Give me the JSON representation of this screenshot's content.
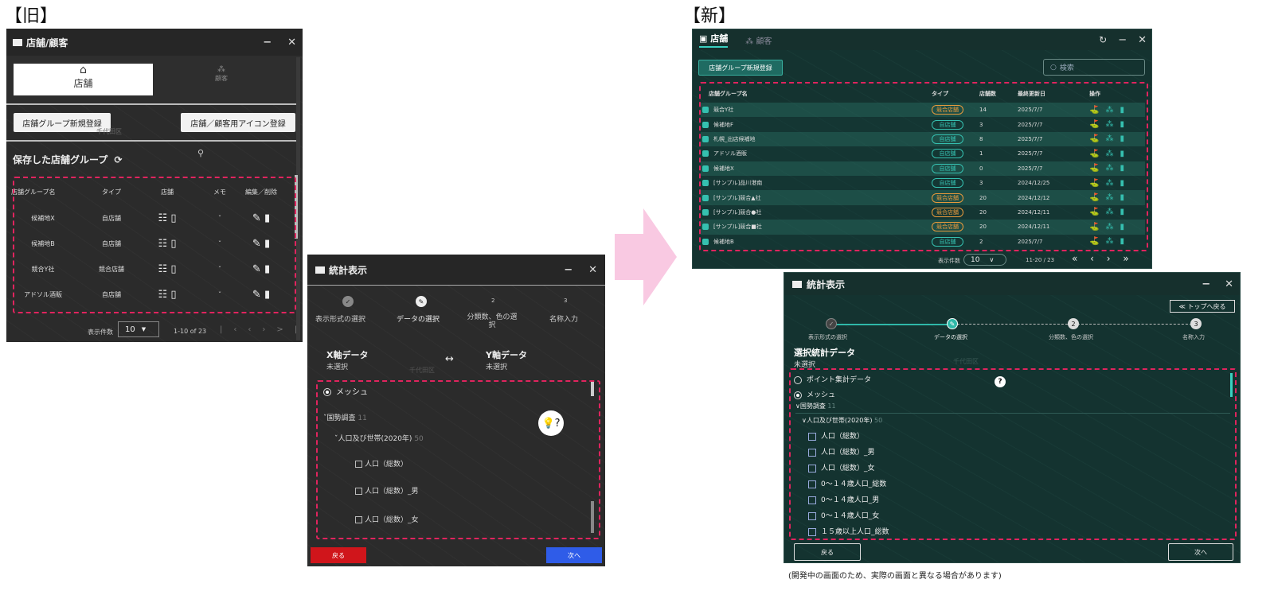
{
  "labels": {
    "old": "【旧】",
    "new": "【新】",
    "footnote": "(開発中の画面のため、実際の画面と異なる場合があります)"
  },
  "old_store": {
    "title": "店舗/顧客",
    "tab_store": "店舗",
    "tab_customer": "顧客",
    "btn_group_register": "店舗グループ新規登録",
    "btn_icon_register": "店舗／顧客用アイコン登録",
    "saved_groups": "保存した店舗グループ",
    "map_label": "千代田区",
    "columns": [
      "店舗グループ名",
      "タイプ",
      "店舗",
      "メモ",
      "編集／削除"
    ],
    "rows": [
      {
        "name": "候補地X",
        "type": "自店舗"
      },
      {
        "name": "候補地B",
        "type": "自店舗"
      },
      {
        "name": "競合Y社",
        "type": "競合店舗"
      },
      {
        "name": "アドソル酒販",
        "type": "自店舗"
      }
    ],
    "page_size_label": "表示件数",
    "page_size": "10",
    "range": "1-10 of 23"
  },
  "old_stats": {
    "title": "統計表示",
    "steps": [
      "表示形式の選択",
      "データの選択",
      "分類数、色の選択",
      "名称入力"
    ],
    "step_nums": [
      "2",
      "3"
    ],
    "x_label": "X軸データ",
    "x_value": "未選択",
    "y_label": "Y軸データ",
    "y_value": "未選択",
    "map_label": "千代田区",
    "mesh": "メッシュ",
    "census": "国勢調査",
    "census_count": "11",
    "pop": "人口及び世帯(2020年)",
    "pop_count": "50",
    "items": [
      "人口（総数）",
      "人口（総数）_男",
      "人口（総数）_女"
    ],
    "back": "戻る",
    "next": "次へ"
  },
  "new_store": {
    "tab_store": "店舗",
    "tab_customer": "顧客",
    "btn_group_register": "店舗グループ新規登録",
    "search_placeholder": "検索",
    "columns": [
      "店舗グループ名",
      "タイプ",
      "店舗数",
      "最終更新日",
      "操作"
    ],
    "rows": [
      {
        "name": "競合Y社",
        "type": "競合店舗",
        "count": "14",
        "date": "2025/7/7",
        "competitor": true
      },
      {
        "name": "候補地F",
        "type": "自店舗",
        "count": "3",
        "date": "2025/7/7",
        "competitor": false
      },
      {
        "name": "札幌_出店候補地",
        "type": "自店舗",
        "count": "8",
        "date": "2025/7/7",
        "competitor": false
      },
      {
        "name": "アドソル酒販",
        "type": "自店舗",
        "count": "1",
        "date": "2025/7/7",
        "competitor": false
      },
      {
        "name": "候補地X",
        "type": "自店舗",
        "count": "0",
        "date": "2025/7/7",
        "competitor": false
      },
      {
        "name": "[サンプル]品川港南",
        "type": "自店舗",
        "count": "3",
        "date": "2024/12/25",
        "competitor": false
      },
      {
        "name": "[サンプル]競合▲社",
        "type": "競合店舗",
        "count": "20",
        "date": "2024/12/12",
        "competitor": true
      },
      {
        "name": "[サンプル]競合●社",
        "type": "競合店舗",
        "count": "20",
        "date": "2024/12/11",
        "competitor": true
      },
      {
        "name": "[サンプル]競合■社",
        "type": "競合店舗",
        "count": "20",
        "date": "2024/12/11",
        "competitor": true
      },
      {
        "name": "候補地B",
        "type": "自店舗",
        "count": "2",
        "date": "2025/7/7",
        "competitor": false
      }
    ],
    "page_size_label": "表示件数",
    "page_size": "10",
    "range": "11-20 / 23"
  },
  "new_stats": {
    "title": "統計表示",
    "back_to_top": "≪ トップへ戻る",
    "steps": [
      "表示形式の選択",
      "データの選択",
      "分類数、色の選択",
      "名称入力"
    ],
    "step_nums": [
      "2",
      "3"
    ],
    "selected_title": "選択統計データ",
    "selected_value": "未選択",
    "map_label": "千代田区",
    "point": "ポイント集計データ",
    "mesh": "メッシュ",
    "census": "国勢調査",
    "census_count": "11",
    "pop": "人口及び世帯(2020年)",
    "pop_count": "50",
    "items": [
      "人口（総数）",
      "人口（総数）_男",
      "人口（総数）_女",
      "0〜１４歳人口_総数",
      "0〜１４歳人口_男",
      "0〜１４歳人口_女",
      "１５歳以上人口_総数"
    ],
    "back": "戻る",
    "next": "次へ"
  },
  "colors": {
    "accent_pink": "#e0245e",
    "teal": "#1f6b62",
    "competitor": "#e89a3c",
    "own": "#35c0b0",
    "arrow": "#f9c9e2"
  }
}
